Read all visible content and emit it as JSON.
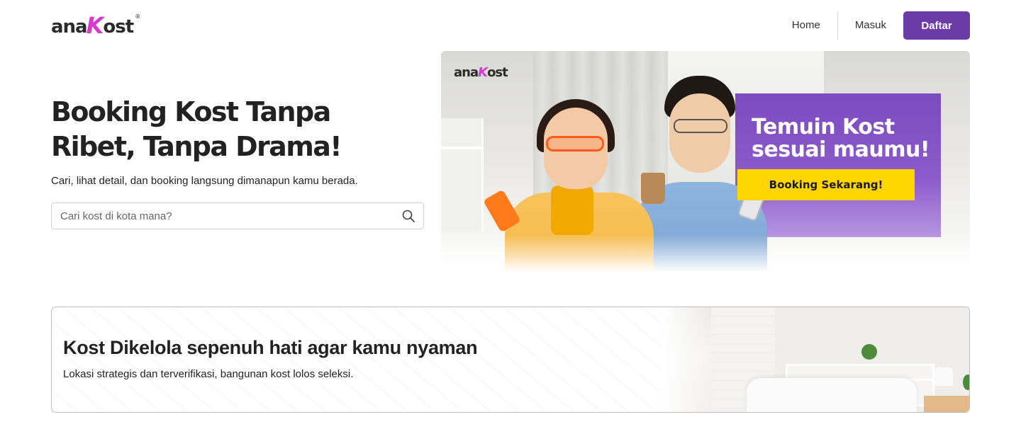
{
  "brand": {
    "logo_prefix": "ana",
    "logo_k": "K",
    "logo_suffix": "ost",
    "reg": "®"
  },
  "nav": {
    "home": "Home",
    "login": "Masuk",
    "register": "Daftar"
  },
  "hero": {
    "title": "Booking Kost Tanpa Ribet, Tanpa Drama!",
    "subtitle": "Cari, lihat detail, dan booking langsung dimanapun kamu berada.",
    "search_placeholder": "Cari kost di kota mana?"
  },
  "banner": {
    "logo_prefix": "ana",
    "logo_k": "K",
    "logo_suffix": "ost",
    "headline": "Temuin Kost sesuai maumu!",
    "cta": "Booking Sekarang!"
  },
  "feature": {
    "title": "Kost Dikelola sepenuh hati agar kamu nyaman",
    "subtitle": "Lokasi strategis dan terverifikasi, bangunan kost lolos seleksi."
  },
  "colors": {
    "primary": "#6b3ba6",
    "accent_pink": "#d63ad0",
    "cta_yellow": "#ffd500",
    "banner_purple": "#7b4bc0"
  },
  "icons": {
    "search": "search-icon"
  }
}
